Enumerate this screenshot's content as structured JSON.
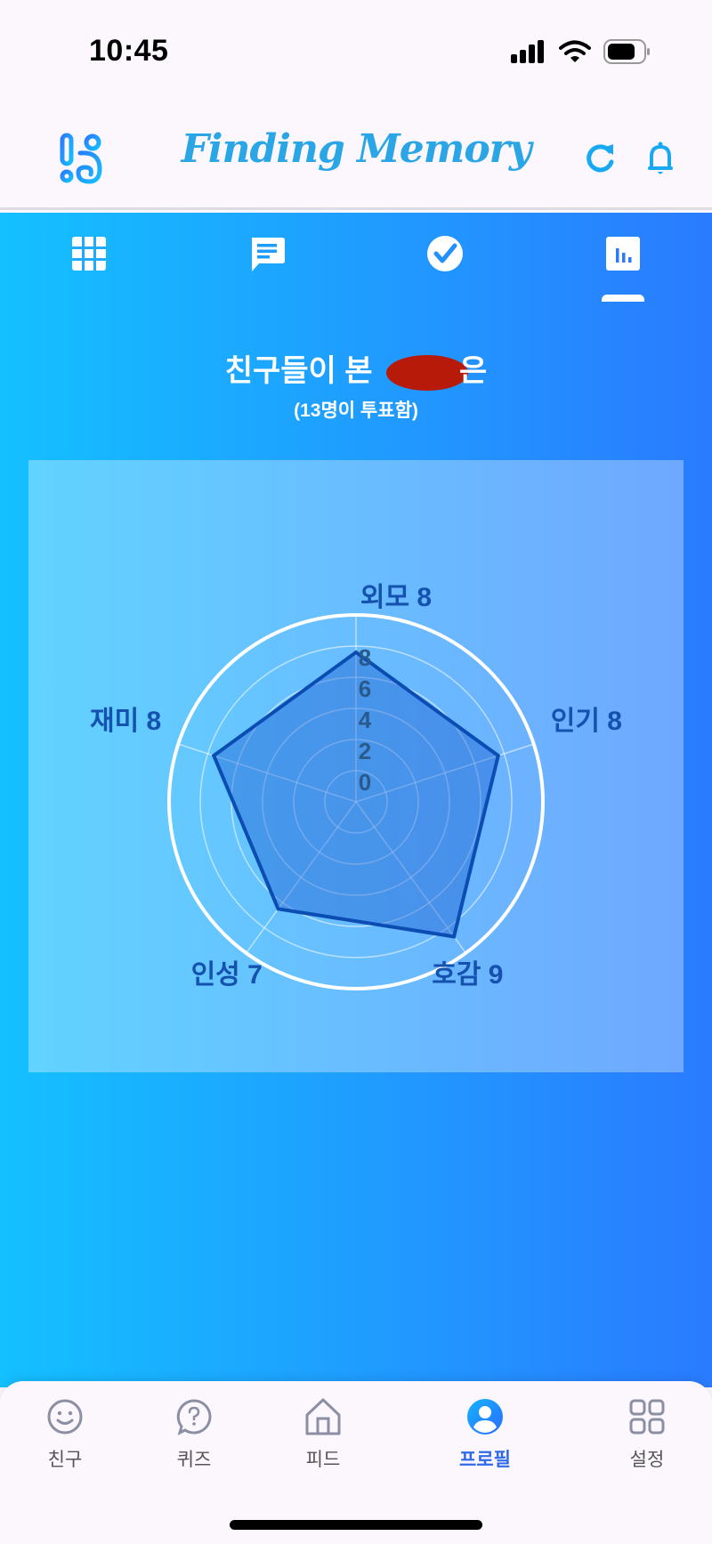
{
  "status_bar": {
    "time": "10:45",
    "icons": [
      "signal-icon",
      "wifi-icon",
      "battery-icon"
    ]
  },
  "header": {
    "logo": "app-logo-icon",
    "title": "Finding Memory",
    "actions": [
      {
        "icon": "refresh-icon"
      },
      {
        "icon": "bell-icon"
      }
    ],
    "accent_color": "#2aa6e6"
  },
  "tabs": [
    {
      "icon": "grid-icon",
      "active": false
    },
    {
      "icon": "chat-icon",
      "active": false
    },
    {
      "icon": "check-circle-icon",
      "active": false
    },
    {
      "icon": "bar-chart-icon",
      "active": true
    }
  ],
  "main": {
    "heading_prefix": "친구들이 본",
    "heading_suffix": "은",
    "subheading": "(13명이 투표함)",
    "gradient": [
      "#14c0ff",
      "#2a7bff"
    ]
  },
  "chart_data": {
    "type": "radar",
    "title": "친구들이 본 [redacted]",
    "axes": [
      "외모",
      "인기",
      "호감",
      "인성",
      "재미"
    ],
    "axis_labels": [
      "외모 8",
      "인기 8",
      "호감 9",
      "인성 7",
      "재미 8"
    ],
    "display_values": [
      8,
      8,
      9,
      7,
      8
    ],
    "values": [
      7.6,
      7.6,
      8.7,
      6.5,
      7.6
    ],
    "radial_ticks": [
      0,
      2,
      4,
      6,
      8
    ],
    "range": [
      -2,
      10
    ],
    "grid": true,
    "series_color": "#0b4db3",
    "fill_color": "rgba(30,100,210,0.45)"
  },
  "bottom_nav": {
    "items": [
      {
        "label": "친구",
        "icon": "smile-icon",
        "active": false
      },
      {
        "label": "퀴즈",
        "icon": "question-bubble-icon",
        "active": false
      },
      {
        "label": "피드",
        "icon": "home-icon",
        "active": false
      },
      {
        "label": "프로필",
        "icon": "profile-icon",
        "active": true
      },
      {
        "label": "설정",
        "icon": "apps-grid-icon",
        "active": false
      }
    ],
    "active_color": "#2f6be8",
    "inactive_color": "#8a8fa3"
  }
}
